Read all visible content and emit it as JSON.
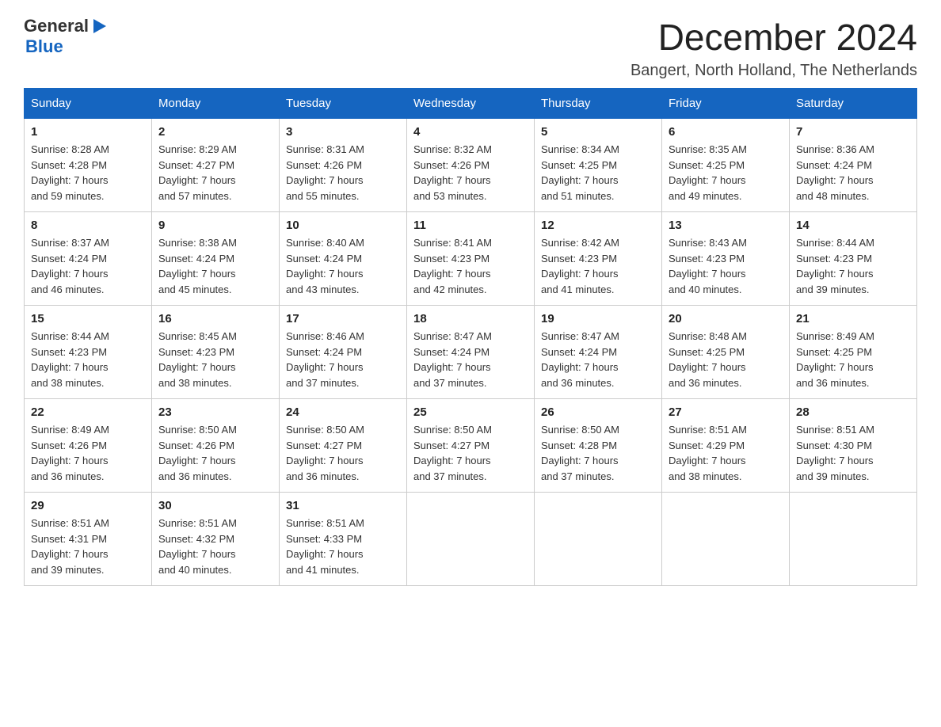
{
  "logo": {
    "general": "General",
    "blue": "Blue",
    "triangle": "▶"
  },
  "title": {
    "month_year": "December 2024",
    "location": "Bangert, North Holland, The Netherlands"
  },
  "weekdays": [
    "Sunday",
    "Monday",
    "Tuesday",
    "Wednesday",
    "Thursday",
    "Friday",
    "Saturday"
  ],
  "weeks": [
    [
      {
        "day": "1",
        "sunrise": "8:28 AM",
        "sunset": "4:28 PM",
        "daylight": "7 hours and 59 minutes."
      },
      {
        "day": "2",
        "sunrise": "8:29 AM",
        "sunset": "4:27 PM",
        "daylight": "7 hours and 57 minutes."
      },
      {
        "day": "3",
        "sunrise": "8:31 AM",
        "sunset": "4:26 PM",
        "daylight": "7 hours and 55 minutes."
      },
      {
        "day": "4",
        "sunrise": "8:32 AM",
        "sunset": "4:26 PM",
        "daylight": "7 hours and 53 minutes."
      },
      {
        "day": "5",
        "sunrise": "8:34 AM",
        "sunset": "4:25 PM",
        "daylight": "7 hours and 51 minutes."
      },
      {
        "day": "6",
        "sunrise": "8:35 AM",
        "sunset": "4:25 PM",
        "daylight": "7 hours and 49 minutes."
      },
      {
        "day": "7",
        "sunrise": "8:36 AM",
        "sunset": "4:24 PM",
        "daylight": "7 hours and 48 minutes."
      }
    ],
    [
      {
        "day": "8",
        "sunrise": "8:37 AM",
        "sunset": "4:24 PM",
        "daylight": "7 hours and 46 minutes."
      },
      {
        "day": "9",
        "sunrise": "8:38 AM",
        "sunset": "4:24 PM",
        "daylight": "7 hours and 45 minutes."
      },
      {
        "day": "10",
        "sunrise": "8:40 AM",
        "sunset": "4:24 PM",
        "daylight": "7 hours and 43 minutes."
      },
      {
        "day": "11",
        "sunrise": "8:41 AM",
        "sunset": "4:23 PM",
        "daylight": "7 hours and 42 minutes."
      },
      {
        "day": "12",
        "sunrise": "8:42 AM",
        "sunset": "4:23 PM",
        "daylight": "7 hours and 41 minutes."
      },
      {
        "day": "13",
        "sunrise": "8:43 AM",
        "sunset": "4:23 PM",
        "daylight": "7 hours and 40 minutes."
      },
      {
        "day": "14",
        "sunrise": "8:44 AM",
        "sunset": "4:23 PM",
        "daylight": "7 hours and 39 minutes."
      }
    ],
    [
      {
        "day": "15",
        "sunrise": "8:44 AM",
        "sunset": "4:23 PM",
        "daylight": "7 hours and 38 minutes."
      },
      {
        "day": "16",
        "sunrise": "8:45 AM",
        "sunset": "4:23 PM",
        "daylight": "7 hours and 38 minutes."
      },
      {
        "day": "17",
        "sunrise": "8:46 AM",
        "sunset": "4:24 PM",
        "daylight": "7 hours and 37 minutes."
      },
      {
        "day": "18",
        "sunrise": "8:47 AM",
        "sunset": "4:24 PM",
        "daylight": "7 hours and 37 minutes."
      },
      {
        "day": "19",
        "sunrise": "8:47 AM",
        "sunset": "4:24 PM",
        "daylight": "7 hours and 36 minutes."
      },
      {
        "day": "20",
        "sunrise": "8:48 AM",
        "sunset": "4:25 PM",
        "daylight": "7 hours and 36 minutes."
      },
      {
        "day": "21",
        "sunrise": "8:49 AM",
        "sunset": "4:25 PM",
        "daylight": "7 hours and 36 minutes."
      }
    ],
    [
      {
        "day": "22",
        "sunrise": "8:49 AM",
        "sunset": "4:26 PM",
        "daylight": "7 hours and 36 minutes."
      },
      {
        "day": "23",
        "sunrise": "8:50 AM",
        "sunset": "4:26 PM",
        "daylight": "7 hours and 36 minutes."
      },
      {
        "day": "24",
        "sunrise": "8:50 AM",
        "sunset": "4:27 PM",
        "daylight": "7 hours and 36 minutes."
      },
      {
        "day": "25",
        "sunrise": "8:50 AM",
        "sunset": "4:27 PM",
        "daylight": "7 hours and 37 minutes."
      },
      {
        "day": "26",
        "sunrise": "8:50 AM",
        "sunset": "4:28 PM",
        "daylight": "7 hours and 37 minutes."
      },
      {
        "day": "27",
        "sunrise": "8:51 AM",
        "sunset": "4:29 PM",
        "daylight": "7 hours and 38 minutes."
      },
      {
        "day": "28",
        "sunrise": "8:51 AM",
        "sunset": "4:30 PM",
        "daylight": "7 hours and 39 minutes."
      }
    ],
    [
      {
        "day": "29",
        "sunrise": "8:51 AM",
        "sunset": "4:31 PM",
        "daylight": "7 hours and 39 minutes."
      },
      {
        "day": "30",
        "sunrise": "8:51 AM",
        "sunset": "4:32 PM",
        "daylight": "7 hours and 40 minutes."
      },
      {
        "day": "31",
        "sunrise": "8:51 AM",
        "sunset": "4:33 PM",
        "daylight": "7 hours and 41 minutes."
      },
      null,
      null,
      null,
      null
    ]
  ]
}
